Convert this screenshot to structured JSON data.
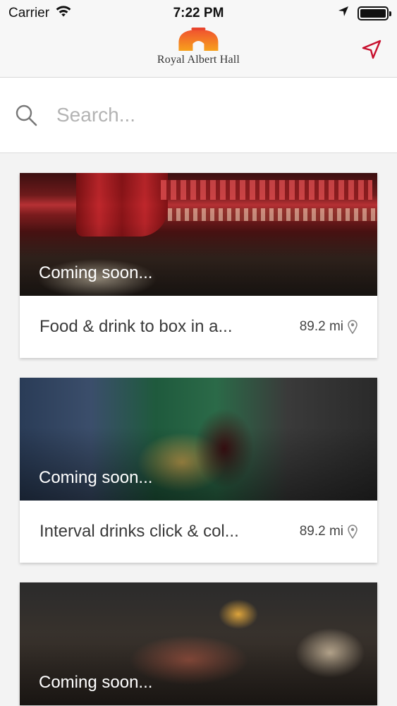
{
  "status_bar": {
    "carrier": "Carrier",
    "time": "7:22 PM"
  },
  "header": {
    "logo_text": "Royal Albert Hall",
    "brand_color": "#e8452c",
    "action_icon": "location-arrow-icon",
    "action_color": "#c8102e"
  },
  "search": {
    "placeholder": "Search...",
    "value": ""
  },
  "cards": [
    {
      "overlay": "Coming soon...",
      "title": "Food & drink to box in a...",
      "distance": "89.2 mi"
    },
    {
      "overlay": "Coming soon...",
      "title": "Interval drinks click & col...",
      "distance": "89.2 mi"
    },
    {
      "overlay": "Coming soon...",
      "title": "",
      "distance": ""
    }
  ]
}
